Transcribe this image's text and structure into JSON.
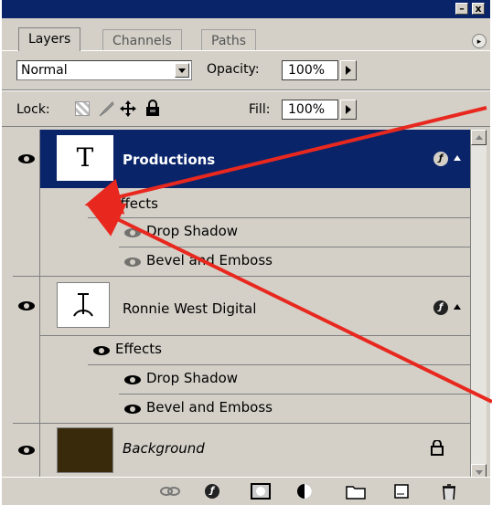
{
  "titlebar": {
    "minimize_label": "–",
    "close_label": "x"
  },
  "tabs": [
    {
      "label": "Layers",
      "active": true
    },
    {
      "label": "Channels",
      "active": false
    },
    {
      "label": "Paths",
      "active": false
    }
  ],
  "menu_button_label": "▸",
  "blend": {
    "mode": "Normal",
    "opacity_label": "Opacity:",
    "opacity_value": "100%"
  },
  "lock": {
    "label": "Lock:",
    "fill_label": "Fill:",
    "fill_value": "100%"
  },
  "layers": [
    {
      "name": "Productions",
      "thumb_text": "T",
      "selected": true,
      "effects_label": "Effects",
      "effects": [
        "Drop Shadow",
        "Bevel and Emboss"
      ]
    },
    {
      "name": "Ronnie West Digital",
      "thumb_text": "T",
      "selected": false,
      "effects_label": "Effects",
      "effects": [
        "Drop Shadow",
        "Bevel and Emboss"
      ]
    },
    {
      "name": "Background",
      "thumb_color": "#3a2a0c",
      "selected": false,
      "locked": true
    }
  ],
  "colors": {
    "selection": "#0a246a",
    "annotation_arrow": "#e8281e",
    "panel": "#d4d0c8"
  },
  "fx_label": "ƒ"
}
